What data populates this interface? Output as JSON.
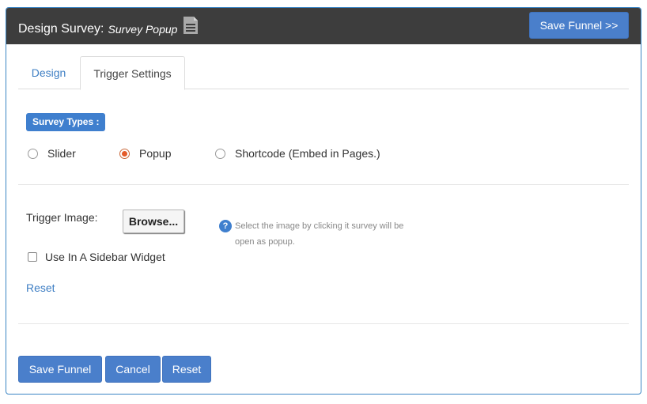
{
  "header": {
    "title": "Design Survey:",
    "subtitle": "Survey Popup",
    "save_label": "Save Funnel >>"
  },
  "tabs": [
    {
      "label": "Design",
      "active": false
    },
    {
      "label": "Trigger Settings",
      "active": true
    }
  ],
  "survey_types": {
    "label": "Survey Types :",
    "options": [
      {
        "label": "Slider",
        "checked": false
      },
      {
        "label": "Popup",
        "checked": true
      },
      {
        "label": "Shortcode (Embed in Pages.)",
        "checked": false
      }
    ]
  },
  "trigger_image": {
    "label": "Trigger Image:",
    "browse_label": "Browse...",
    "help_text": "Select the image by clicking it survey will be open as popup."
  },
  "sidebar_widget": {
    "label": "Use In A Sidebar Widget",
    "checked": false
  },
  "reset_link": "Reset",
  "footer": {
    "save_label": "Save Funnel",
    "cancel_label": "Cancel",
    "reset_label": "Reset"
  },
  "colors": {
    "primary": "#4a7fcb",
    "header_bg": "#3d3d3d",
    "link": "#3f7fc4",
    "radio_checked": "#e45a28"
  }
}
